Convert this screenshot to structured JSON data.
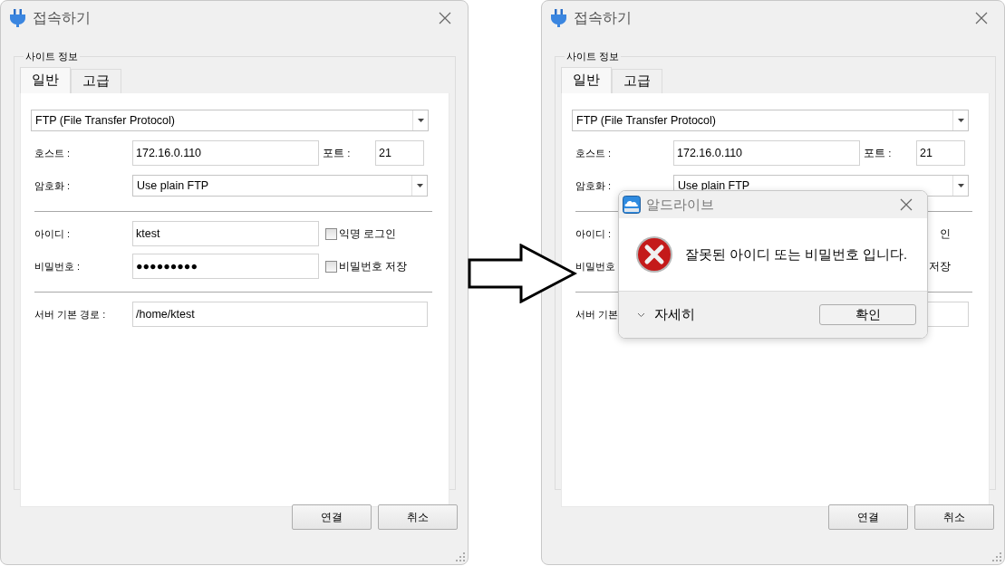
{
  "windows": [
    {
      "title": "접속하기",
      "group_title": "사이트 정보",
      "tabs": [
        {
          "label": "일반",
          "selected": true
        },
        {
          "label": "고급",
          "selected": false
        }
      ],
      "protocol": "FTP (File Transfer Protocol)",
      "sections": [
        [
          {
            "kind": "text",
            "label": "호스트 :",
            "value": "172.16.0.110",
            "extra_label": "포트 :",
            "extra_value": "21"
          },
          {
            "kind": "select",
            "label": "암호화 :",
            "value": "Use plain FTP"
          }
        ],
        [
          {
            "kind": "text",
            "label": "아이디 :",
            "value": "ktest",
            "checkbox": {
              "label": "익명 로그인",
              "checked": false
            }
          },
          {
            "kind": "text",
            "label": "비밀번호 :",
            "value": "●●●●●●●●●",
            "checkbox": {
              "label": "비밀번호 저장",
              "checked": false
            }
          }
        ],
        [
          {
            "kind": "text",
            "label": "서버 기본 경로 :",
            "value": "/home/ktest"
          }
        ]
      ],
      "buttons": [
        "연결",
        "취소"
      ]
    },
    {
      "title": "접속하기",
      "group_title": "사이트 정보",
      "tabs": [
        {
          "label": "일반",
          "selected": true
        },
        {
          "label": "고급",
          "selected": false
        }
      ],
      "protocol": "FTP (File Transfer Protocol)",
      "sections": [
        [
          {
            "kind": "text",
            "label": "호스트 :",
            "value": "172.16.0.110",
            "extra_label": "포트 :",
            "extra_value": "21"
          },
          {
            "kind": "select",
            "label": "암호화 :",
            "value": "Use plain FTP"
          }
        ],
        [
          {
            "kind": "covered",
            "label": "아이디 :",
            "side_text": "인"
          },
          {
            "kind": "covered",
            "label": "비밀번호",
            "side_text": "저장"
          }
        ],
        [
          {
            "kind": "text",
            "label": "서버 기본"
          }
        ]
      ],
      "buttons": [
        "연결",
        "취소"
      ],
      "dialog": {
        "title": "알드라이브",
        "message": "잘못된 아이디 또는 비밀번호 입니다.",
        "details": "자세히",
        "button": "확인"
      }
    }
  ]
}
